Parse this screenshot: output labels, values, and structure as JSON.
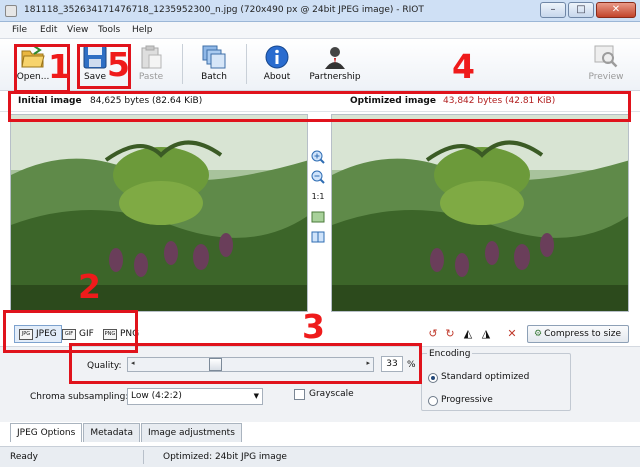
{
  "window": {
    "title": "181118_352634171476718_1235952300_n.jpg (720x490 px @ 24bit JPEG image) - RIOT",
    "buttons": {
      "minimize": "–",
      "maximize": "□",
      "close": "✕"
    }
  },
  "menu": [
    "File",
    "Edit",
    "View",
    "Tools",
    "Help"
  ],
  "toolbar": {
    "open": "Open...",
    "save": "Save",
    "paste": "Paste",
    "batch": "Batch",
    "about": "About",
    "partnership": "Partnership",
    "preview": "Preview"
  },
  "info": {
    "initial_label": "Initial image",
    "initial_value": "84,625 bytes (82.64 KiB)",
    "optimized_label": "Optimized image",
    "optimized_value": "43,842 bytes (42.81 KiB)"
  },
  "zoom_tools": {
    "actual_size": "1:1"
  },
  "formats": [
    "JPEG",
    "GIF",
    "PNG"
  ],
  "compress_button": "Compress to size",
  "options": {
    "quality_label": "Quality:",
    "quality_value": "33",
    "quality_percent": 33,
    "quality_unit": "%",
    "chroma_label": "Chroma subsampling:",
    "chroma_value": "Low (4:2:2)",
    "grayscale_label": "Grayscale",
    "encoding_title": "Encoding",
    "encoding_standard": "Standard optimized",
    "encoding_progressive": "Progressive"
  },
  "tabs": [
    "JPEG Options",
    "Metadata",
    "Image adjustments"
  ],
  "status": {
    "left": "Ready",
    "right": "Optimized: 24bit JPG image"
  },
  "annotations": [
    "1",
    "2",
    "3",
    "4",
    "5"
  ],
  "colors": {
    "annotation": "#e0131c",
    "optimized_value": "#b22222"
  }
}
